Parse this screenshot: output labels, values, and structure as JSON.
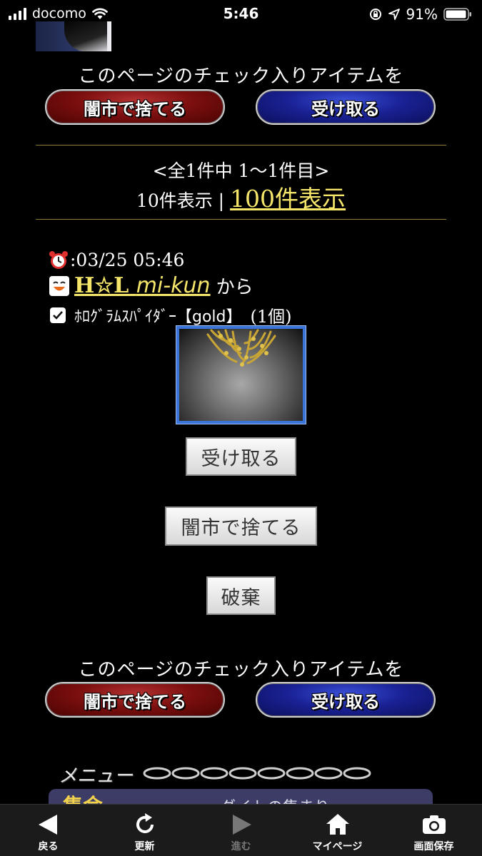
{
  "status_bar": {
    "carrier": "docomo",
    "time": "5:46",
    "battery": "91%"
  },
  "bulk_top": {
    "caption": "このページのチェック入りアイテムを",
    "discard_label": "闇市で捨てる",
    "receive_label": "受け取る"
  },
  "pager": {
    "range_text": "<全1件中 1〜1件目>",
    "size_10": "10件表示 | ",
    "size_100": "100件表示"
  },
  "item": {
    "time": ":03/25 05:46",
    "sender_prefix": "H☆L ",
    "sender_script": "mi-kun",
    "from_suffix": "から",
    "name": "ﾎﾛｸﾞﾗﾑｽﾊﾟｲﾀﾞｰ【gold】",
    "quantity": "(1個)",
    "checked": true,
    "receive_btn": "受け取る",
    "blackmarket_btn": "闇市で捨てる",
    "destroy_btn": "破棄"
  },
  "bulk_bottom": {
    "caption": "このページのチェック入りアイテムを",
    "discard_label": "闇市で捨てる",
    "receive_label": "受け取る"
  },
  "menu": {
    "header": "メニュー",
    "section_title": "集会",
    "section_sub": "ダイトの集まり"
  },
  "toolbar": {
    "back": "戻る",
    "refresh": "更新",
    "forward": "進む",
    "mypage": "マイページ",
    "screenshot": "画面保存"
  },
  "colors": {
    "link_gold": "#f5e66a",
    "divider_gold": "#8f7a3a",
    "red_button": "#7d0f0f",
    "blue_button": "#1a2296"
  }
}
